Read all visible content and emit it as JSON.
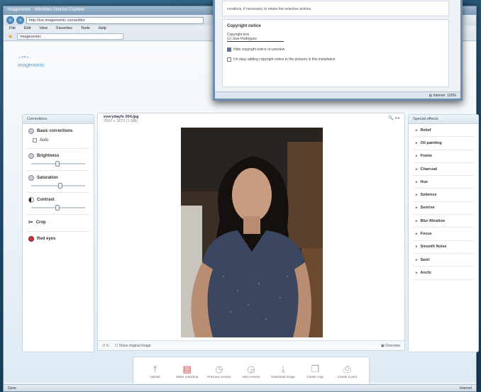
{
  "browser": {
    "title": "Imagenomic - Windows Internet Explorer",
    "address": "http://ice.imagenomic.com/editor",
    "menu": [
      "File",
      "Edit",
      "View",
      "Favorites",
      "Tools",
      "Help"
    ],
    "tab": "Imagenomic",
    "status_left": "Done",
    "status_right": "Internet"
  },
  "app": {
    "logo": "imagenomic",
    "left_panel": {
      "title": "Corrections",
      "items": {
        "basic": "Basic corrections",
        "auto": "Auto",
        "brightness": "Brightness",
        "saturation": "Saturation",
        "contrast": "Contrast",
        "crop": "Crop",
        "redeye": "Red eyes"
      }
    },
    "image": {
      "filename": "everydayfo 004.jpg",
      "info": "2592 x 3872 (1 MB)",
      "show_original": "Show original image",
      "overview": "Overview"
    },
    "right_panel": {
      "title": "Special effects",
      "effects": [
        "Relief",
        "Oil painting",
        "Frame",
        "Charcoal",
        "Hue",
        "Sobence",
        "Sunrise",
        "Blur filtration",
        "Focus",
        "Smooth Noise",
        "Swirl",
        "Anchi"
      ]
    },
    "toolbar": [
      "Upload",
      "Make a Backup",
      "Previous version",
      "Next version",
      "Download image",
      "Create copy",
      "Create a print"
    ]
  },
  "dialog": {
    "top_text": "creations, if necessary, to retake the selective actions.",
    "heading": "Copyright notice",
    "line1": "Copyright text",
    "line2": "(c) Jose Rodriguez",
    "check1": "Hide copyright notice on preview",
    "check2": "I'm okay adding copyright notice to the pictures in this installation",
    "status_left": "Internet",
    "status_right": "100%"
  },
  "colors": {
    "accent": "#4a78a8",
    "panel_border": "#c7d5e1",
    "desktop": "#1f4a69"
  }
}
